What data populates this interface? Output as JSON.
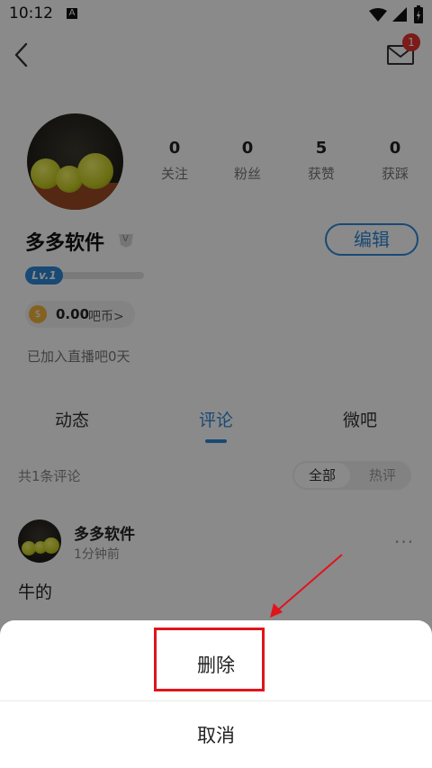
{
  "status_bar": {
    "time": "10:12",
    "notif_letter": "A"
  },
  "header": {
    "mail_badge": "1"
  },
  "profile": {
    "stats": [
      {
        "value": "0",
        "label": "关注"
      },
      {
        "value": "0",
        "label": "粉丝"
      },
      {
        "value": "5",
        "label": "获赞"
      },
      {
        "value": "0",
        "label": "获踩"
      }
    ],
    "username": "多多软件",
    "vip_mark": "V",
    "edit_label": "编辑",
    "level": "Lv.1",
    "level_progress": 0.0,
    "coins": "0.00",
    "coin_label": "吧币>",
    "joined_text": "已加入直播吧0天"
  },
  "tabs": {
    "items": [
      "动态",
      "评论",
      "微吧"
    ],
    "active": "评论"
  },
  "comments": {
    "count_text": "共1条评论",
    "filters": [
      "全部",
      "热评"
    ],
    "items": [
      {
        "user": "多多软件",
        "time": "1分钟前",
        "text": "牛的",
        "more": "···"
      }
    ]
  },
  "action_sheet": {
    "delete_label": "删除",
    "cancel_label": "取消"
  },
  "colors": {
    "accent": "#2f88d8",
    "highlight": "#e0141b",
    "badge": "#e5322d"
  }
}
